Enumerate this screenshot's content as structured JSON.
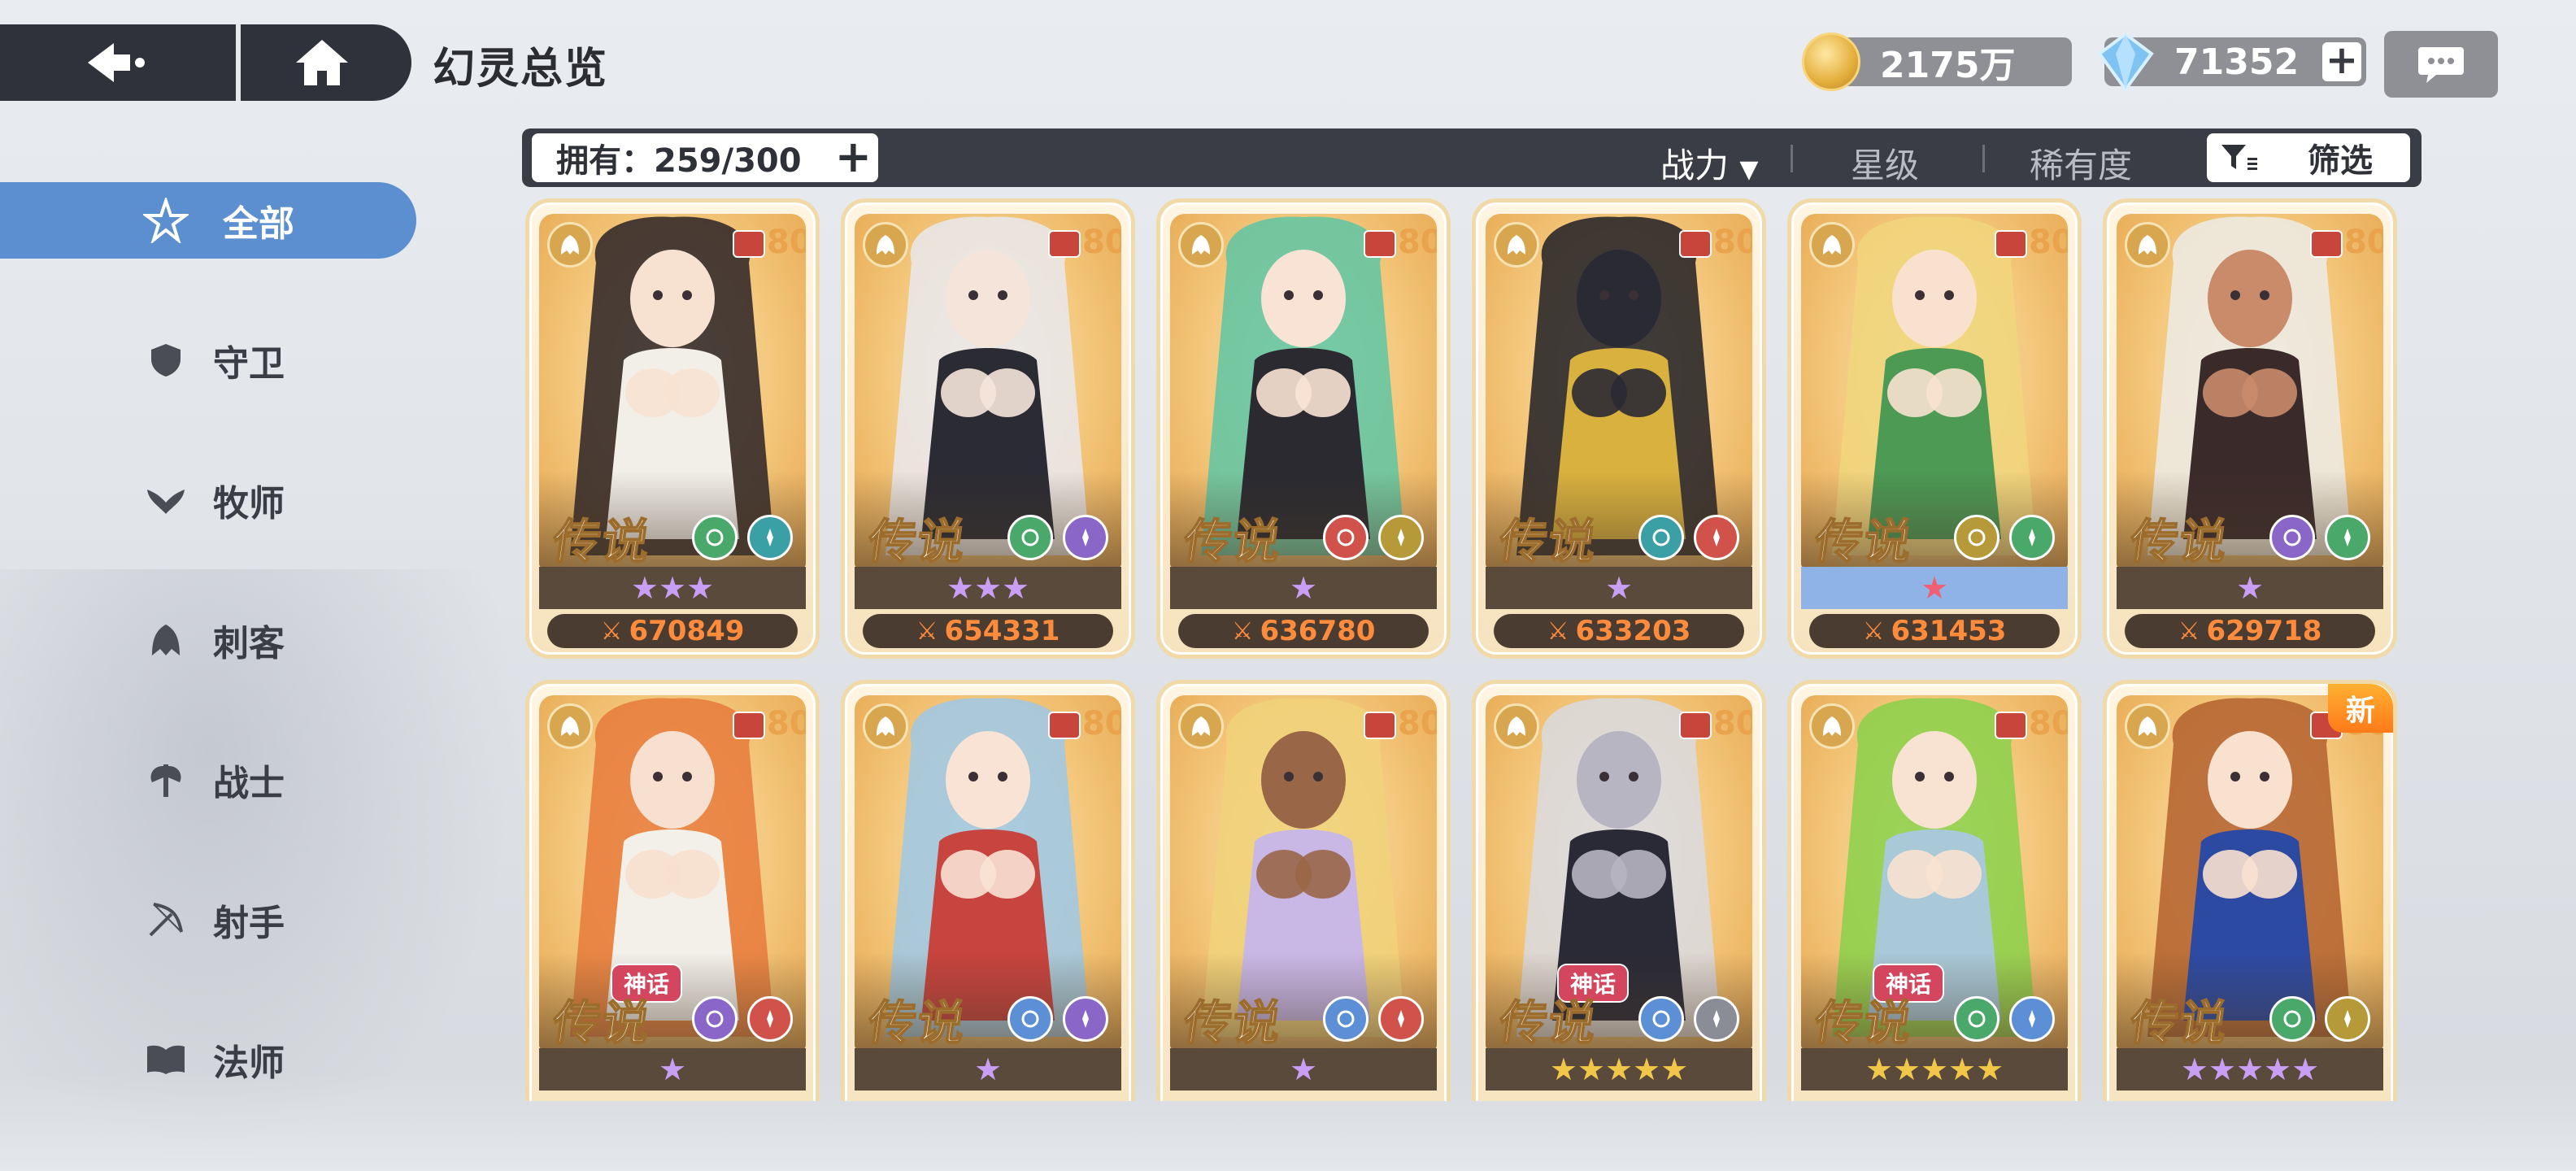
{
  "header": {
    "title": "幻灵总览",
    "gold": "2175万",
    "gems": "71352"
  },
  "sidebar": {
    "items": [
      {
        "label": "全部",
        "icon": "all-star-icon"
      },
      {
        "label": "守卫",
        "icon": "shield-icon"
      },
      {
        "label": "牧师",
        "icon": "wing-heart-icon"
      },
      {
        "label": "刺客",
        "icon": "claw-icon"
      },
      {
        "label": "战士",
        "icon": "axe-icon"
      },
      {
        "label": "射手",
        "icon": "bow-icon"
      },
      {
        "label": "法师",
        "icon": "book-icon"
      }
    ]
  },
  "filter": {
    "owned": "拥有：259/300",
    "sort_power": "战力",
    "sort_star": "星级",
    "sort_rarity": "稀有度",
    "filter_label": "筛选"
  },
  "cards": [
    {
      "level": "80",
      "rarity": "传说",
      "stars": "★★★",
      "power": "670849",
      "myth": "",
      "new": "",
      "hair": "#2a2226",
      "skin": "#f7e2d1",
      "outfit": "#f2efe9",
      "class_color": "#d7a64e",
      "e1": "#4aa86a",
      "e2": "#3b9fa6",
      "star_style": ""
    },
    {
      "level": "80",
      "rarity": "传说",
      "stars": "★★★",
      "power": "654331",
      "myth": "",
      "new": "",
      "hair": "#e9e9ee",
      "skin": "#f5e4da",
      "outfit": "#2b2b33",
      "class_color": "#d7a64e",
      "e1": "#4aa86a",
      "e2": "#8a66c9",
      "star_style": ""
    },
    {
      "level": "80",
      "rarity": "传说",
      "stars": "★",
      "power": "636780",
      "myth": "",
      "new": "",
      "hair": "#5ec6a4",
      "skin": "#f8e3d5",
      "outfit": "#2a2a30",
      "class_color": "#d7a64e",
      "e1": "#d1524a",
      "e2": "#b69a3a",
      "star_style": ""
    },
    {
      "level": "80",
      "rarity": "传说",
      "stars": "★",
      "power": "633203",
      "myth": "",
      "new": "",
      "hair": "#1e1e26",
      "skin": "#2a2a34",
      "outfit": "#d9b13e",
      "class_color": "#d7a64e",
      "e1": "#3b9fa6",
      "e2": "#d1524a",
      "star_style": ""
    },
    {
      "level": "80",
      "rarity": "传说",
      "stars": "★",
      "power": "631453",
      "myth": "",
      "new": "",
      "hair": "#f0d67c",
      "skin": "#f8e2cf",
      "outfit": "#4d9a55",
      "class_color": "#d7a64e",
      "e1": "#b69a3a",
      "e2": "#4aa86a",
      "star_style": "blue"
    },
    {
      "level": "80",
      "rarity": "传说",
      "stars": "★",
      "power": "629718",
      "myth": "",
      "new": "",
      "hair": "#ecebe6",
      "skin": "#c98b6a",
      "outfit": "#3b2a2a",
      "class_color": "#d7a64e",
      "e1": "#8a66c9",
      "e2": "#4aa86a",
      "star_style": ""
    },
    {
      "level": "80",
      "rarity": "传说",
      "stars": "★",
      "power": "",
      "myth": "神话",
      "new": "",
      "hair": "#e77a3b",
      "skin": "#f7e0cf",
      "outfit": "#f3f0ea",
      "class_color": "#d7a64e",
      "e1": "#8a66c9",
      "e2": "#d1524a",
      "star_style": ""
    },
    {
      "level": "80",
      "rarity": "传说",
      "stars": "★",
      "power": "",
      "myth": "",
      "new": "",
      "hair": "#9cc8e8",
      "skin": "#f8e3d5",
      "outfit": "#c8443e",
      "class_color": "#d7a64e",
      "e1": "#5c8fd6",
      "e2": "#8a66c9",
      "star_style": ""
    },
    {
      "level": "80",
      "rarity": "传说",
      "stars": "★",
      "power": "",
      "myth": "",
      "new": "",
      "hair": "#f0d27a",
      "skin": "#9a6648",
      "outfit": "#c9b7e6",
      "class_color": "#d7a64e",
      "e1": "#5c8fd6",
      "e2": "#d1524a",
      "star_style": ""
    },
    {
      "level": "80",
      "rarity": "传说",
      "stars": "★★★★★",
      "power": "",
      "myth": "神话",
      "new": "",
      "hair": "#d9dbe2",
      "skin": "#b7b5c2",
      "outfit": "#2a2a36",
      "class_color": "#d7a64e",
      "e1": "#5c8fd6",
      "e2": "#8a8c96",
      "star_style": "gold"
    },
    {
      "level": "80",
      "rarity": "传说",
      "stars": "★★★★★",
      "power": "",
      "myth": "神话",
      "new": "",
      "hair": "#8ad14a",
      "skin": "#f8e2d2",
      "outfit": "#a9c9d8",
      "class_color": "#d7a64e",
      "e1": "#4aa86a",
      "e2": "#5c8fd6",
      "star_style": "gold"
    },
    {
      "level": "80",
      "rarity": "传说",
      "stars": "★★★★★",
      "power": "",
      "myth": "",
      "new": "新",
      "hair": "#b3602e",
      "skin": "#f8e1cf",
      "outfit": "#2d4aa3",
      "class_color": "#d7a64e",
      "e1": "#4aa86a",
      "e2": "#b69a3a",
      "star_style": ""
    }
  ]
}
